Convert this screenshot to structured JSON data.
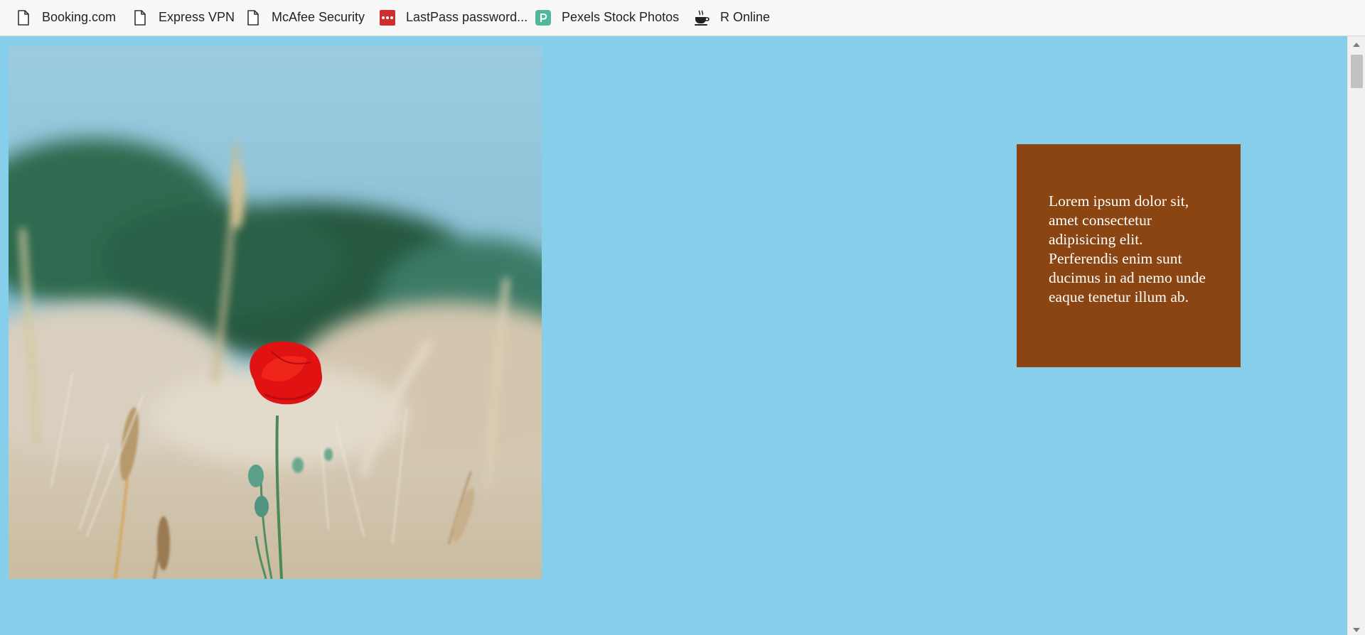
{
  "bookmarks": [
    {
      "label": "Booking.com",
      "icon": "page-icon"
    },
    {
      "label": "Express VPN",
      "icon": "page-icon"
    },
    {
      "label": "McAfee Security",
      "icon": "page-icon"
    },
    {
      "label": "LastPass password...",
      "icon": "lastpass-icon"
    },
    {
      "label": "Pexels Stock Photos",
      "icon": "pexels-icon"
    },
    {
      "label": "R Online",
      "icon": "coffee-cup-icon"
    }
  ],
  "page": {
    "background_color": "#87ceeb",
    "photo": {
      "subject": "red poppy in a wheat field"
    },
    "text_box": {
      "background_color": "#8b4513",
      "text": "Lorem ipsum dolor sit, amet consectetur adipisicing elit. Perferendis enim sunt ducimus in ad nemo unde eaque tenetur illum ab."
    }
  }
}
